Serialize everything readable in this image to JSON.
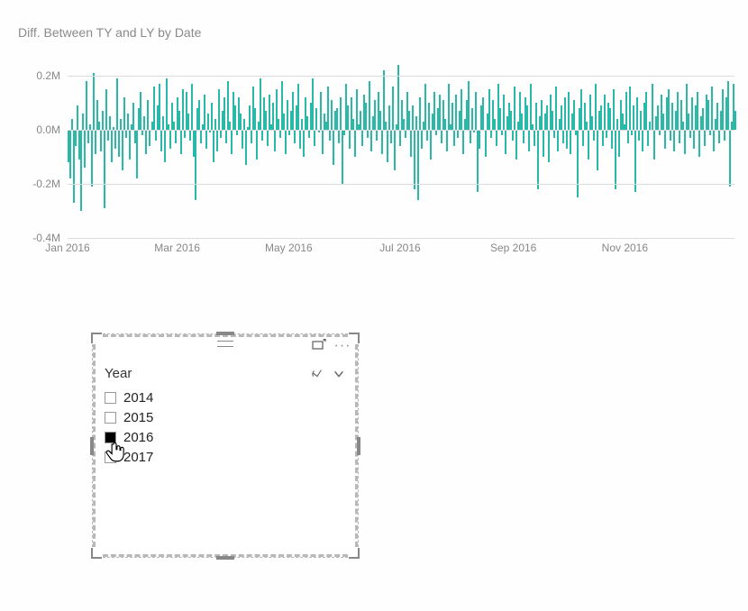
{
  "chart_data": {
    "type": "bar",
    "title": "Diff. Between TY and LY by Date",
    "xlabel": "",
    "ylabel": "",
    "ylim": [
      -0.4,
      0.3
    ],
    "y_ticks": [
      -0.4,
      -0.2,
      0.0,
      0.2
    ],
    "y_tick_labels": [
      "-0.4M",
      "-0.2M",
      "0.0M",
      "0.2M"
    ],
    "x_tick_labels": [
      "Jan 2016",
      "Mar 2016",
      "May 2016",
      "Jul 2016",
      "Sep 2016",
      "Nov 2016"
    ],
    "x_tick_positions_days": [
      0,
      60,
      121,
      182,
      244,
      305
    ],
    "x_range_days": 365,
    "values": [
      -0.12,
      -0.18,
      0.04,
      -0.27,
      -0.06,
      0.09,
      -0.11,
      -0.3,
      0.06,
      -0.14,
      0.18,
      -0.05,
      0.02,
      -0.21,
      0.21,
      -0.09,
      0.11,
      0.03,
      -0.08,
      0.07,
      -0.29,
      0.15,
      -0.04,
      0.05,
      -0.12,
      0.01,
      -0.07,
      0.19,
      -0.1,
      0.04,
      -0.15,
      0.12,
      -0.03,
      0.06,
      -0.11,
      0.02,
      0.1,
      -0.05,
      -0.18,
      0.08,
      0.14,
      -0.02,
      0.05,
      -0.09,
      0.11,
      -0.06,
      0.03,
      0.16,
      -0.04,
      0.09,
      0.17,
      -0.08,
      0.05,
      -0.12,
      0.19,
      0.02,
      -0.07,
      0.1,
      0.03,
      -0.05,
      0.12,
      0.07,
      -0.09,
      0.15,
      -0.03,
      0.14,
      0.06,
      -0.04,
      0.17,
      -0.1,
      -0.26,
      0.08,
      0.11,
      -0.05,
      0.02,
      0.13,
      -0.07,
      0.06,
      -0.01,
      0.1,
      -0.12,
      0.04,
      -0.08,
      0.15,
      -0.03,
      0.07,
      0.12,
      -0.05,
      0.18,
      0.03,
      -0.09,
      0.14,
      0.09,
      -0.02,
      0.12,
      0.06,
      -0.07,
      0.04,
      -0.13,
      0.01,
      0.09,
      -0.05,
      0.16,
      0.08,
      -0.11,
      0.03,
      0.19,
      -0.04,
      0.12,
      0.07,
      -0.06,
      0.13,
      0.02,
      0.1,
      -0.08,
      0.15,
      0.04,
      -0.03,
      0.18,
      0.06,
      -0.09,
      0.11,
      -0.02,
      0.07,
      0.14,
      -0.05,
      0.09,
      0.17,
      -0.07,
      0.04,
      -0.1,
      0.12,
      0.05,
      -0.03,
      0.1,
      0.19,
      -0.06,
      0.08,
      -0.01,
      0.14,
      -0.09,
      0.06,
      0.03,
      0.16,
      -0.04,
      0.11,
      -0.13,
      0.07,
      0.08,
      -0.05,
      0.12,
      -0.2,
      -0.02,
      0.17,
      0.09,
      -0.07,
      0.12,
      0.04,
      -0.1,
      0.15,
      0.02,
      0.07,
      -0.06,
      0.13,
      0.1,
      -0.03,
      0.18,
      -0.08,
      0.05,
      0.11,
      -0.04,
      0.14,
      0.07,
      -0.09,
      0.22,
      0.03,
      -0.12,
      0.09,
      -0.05,
      0.16,
      -0.15,
      0.02,
      0.24,
      -0.06,
      0.11,
      0.04,
      -0.03,
      0.14,
      0.07,
      -0.1,
      0.09,
      -0.22,
      0.05,
      -0.26,
      0.12,
      -0.07,
      0.03,
      0.17,
      -0.04,
      0.1,
      -0.11,
      0.06,
      0.14,
      -0.02,
      0.08,
      0.13,
      -0.05,
      0.11,
      0.04,
      -0.08,
      0.17,
      0.02,
      0.1,
      -0.06,
      0.13,
      -0.03,
      0.07,
      0.15,
      -0.09,
      0.04,
      0.11,
      0.18,
      -0.05,
      0.08,
      -0.01,
      0.14,
      -0.23,
      -0.07,
      0.09,
      0.12,
      -0.1,
      0.06,
      0.15,
      -0.03,
      0.11,
      0.04,
      -0.06,
      0.17,
      0.08,
      -0.02,
      0.13,
      -0.09,
      0.05,
      0.1,
      0.07,
      -0.04,
      0.16,
      -0.11,
      0.03,
      0.14,
      0.06,
      -0.05,
      0.12,
      0.09,
      -0.08,
      0.17,
      0.02,
      -0.06,
      0.1,
      -0.22,
      0.05,
      0.11,
      -0.1,
      0.06,
      0.09,
      -0.12,
      0.13,
      0.07,
      -0.03,
      0.16,
      -0.08,
      0.04,
      0.09,
      -0.05,
      0.12,
      -0.07,
      0.14,
      -0.09,
      0.06,
      0.11,
      -0.02,
      -0.25,
      0.08,
      0.15,
      -0.06,
      0.1,
      0.03,
      -0.11,
      0.13,
      0.05,
      -0.04,
      0.17,
      -0.15,
      0.07,
      0.09,
      -0.06,
      0.13,
      -0.03,
      0.1,
      0.08,
      -0.07,
      0.15,
      -0.22,
      0.04,
      -0.1,
      0.11,
      0.06,
      0.02,
      0.14,
      -0.05,
      0.16,
      -0.02,
      0.09,
      -0.23,
      0.12,
      -0.04,
      0.07,
      -0.08,
      0.1,
      0.14,
      -0.06,
      0.03,
      0.17,
      -0.11,
      0.05,
      0.09,
      -0.02,
      0.13,
      0.06,
      -0.07,
      0.12,
      0.15,
      -0.04,
      0.1,
      -0.08,
      0.07,
      0.14,
      -0.05,
      0.11,
      0.03,
      -0.09,
      0.17,
      0.06,
      -0.03,
      0.12,
      -0.07,
      0.09,
      0.14,
      -0.1,
      0.05,
      0.08,
      -0.06,
      0.13,
      0.11,
      -0.02,
      0.16,
      -0.08,
      0.04,
      0.1,
      -0.05,
      0.07,
      0.15,
      -0.04,
      0.12,
      0.18,
      -0.21,
      0.03,
      0.17,
      0.07
    ]
  },
  "slicer": {
    "header_label": "Year",
    "items": [
      {
        "label": "2014",
        "checked": false
      },
      {
        "label": "2015",
        "checked": false
      },
      {
        "label": "2016",
        "checked": true
      },
      {
        "label": "2017",
        "checked": false
      }
    ]
  }
}
